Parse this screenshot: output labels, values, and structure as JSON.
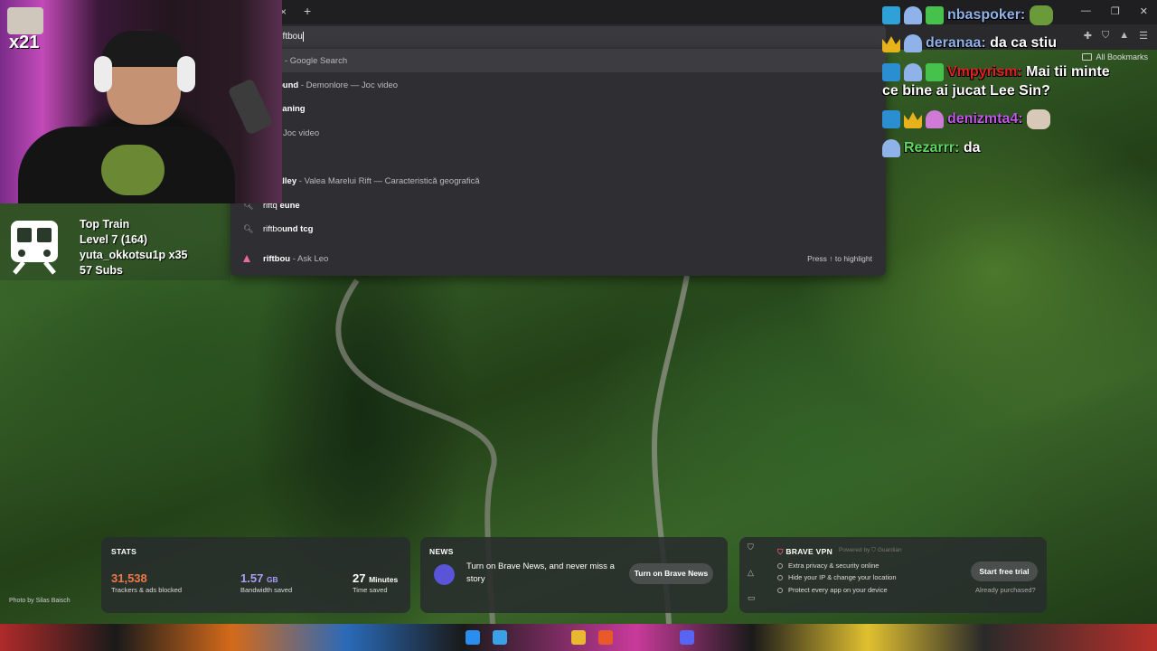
{
  "browser": {
    "address_text": "riftbou",
    "bookmarks_label": "All Bookmarks",
    "tab_close": "×",
    "tab_new": "+"
  },
  "suggestions": [
    {
      "icon": "search-icon",
      "main": "u",
      "sub": " - Google Search"
    },
    {
      "icon": "search-icon",
      "main": "ound",
      "sub": " - Demonlore — Joc video"
    },
    {
      "icon": "search-icon",
      "main": "eaning",
      "sub": ""
    },
    {
      "icon": "search-icon",
      "main": "",
      "sub": "Joc video"
    },
    {
      "icon": "search-icon",
      "main": "",
      "sub": ""
    },
    {
      "icon": "search-icon",
      "main": "alley",
      "sub": " - Valea Marelui Rift — Caracteristică geografică"
    },
    {
      "icon": "search-icon",
      "main_light": "riftq",
      "main": " eune",
      "sub": ""
    },
    {
      "icon": "search-icon",
      "main_light": "riftbo",
      "main": "und tcg",
      "sub": ""
    },
    {
      "icon": "leo-icon",
      "main": "riftbou",
      "sub": " - Ask Leo"
    }
  ],
  "press_hint": "Press ↑ to highlight",
  "webcam": {
    "sub_count_badge": "x21"
  },
  "sub_train": {
    "title": "Top Train",
    "level": "Level 7  (164)",
    "top_user": "yuta_okkotsu1p x35",
    "subs": "57 Subs"
  },
  "chat": [
    {
      "user": "nbaspoker:",
      "user_color": "#8fb2e8",
      "text": "",
      "badges": [
        "b-purple",
        "b-ghost",
        "b-gift"
      ],
      "emote": "#6a9a3a"
    },
    {
      "user": "deranaa:",
      "user_color": "#8fb2e8",
      "text": "da ca stiu",
      "badges": [
        "b-crown",
        "b-ghost"
      ]
    },
    {
      "user": "Vmpyrism:",
      "user_color": "#e02020",
      "text": "Mai tii minte",
      "badges": [
        "b-hammer",
        "b-ghost",
        "b-gift"
      ]
    },
    {
      "user": "",
      "user_color": "#fff",
      "text": "ce bine ai jucat Lee Sin?",
      "badges": []
    },
    {
      "user": "denizmta4:",
      "user_color": "#c058e8",
      "text": "",
      "badges": [
        "b-hammer",
        "b-crown",
        "b-pink"
      ],
      "emote": "#d8c8b8"
    },
    {
      "user": "Rezarrr:",
      "user_color": "#5ed85e",
      "text": "da",
      "badges": [
        "b-ghost"
      ]
    }
  ],
  "stats": {
    "title": "STATS",
    "trackers_value": "31,538",
    "trackers_label": "Trackers & ads blocked",
    "bandwidth_value": "1.57",
    "bandwidth_unit": "GB",
    "bandwidth_label": "Bandwidth saved",
    "time_value": "27",
    "time_unit": "Minutes",
    "time_label": "Time saved",
    "colors": {
      "trackers": "#f07848",
      "bandwidth": "#a8a0f8",
      "time": "#ffffff"
    }
  },
  "news": {
    "title": "NEWS",
    "text": "Turn on Brave News, and never miss a story",
    "button": "Turn on Brave News"
  },
  "vpn": {
    "title": "BRAVE VPN",
    "powered": "Powered by",
    "guardian": "Guardian",
    "features": [
      "Extra privacy & security online",
      "Hide your IP & change your location",
      "Protect every app on your device"
    ],
    "button": "Start free trial",
    "already": "Already purchased?"
  },
  "photo_credit": "Photo by Silas Baisch"
}
